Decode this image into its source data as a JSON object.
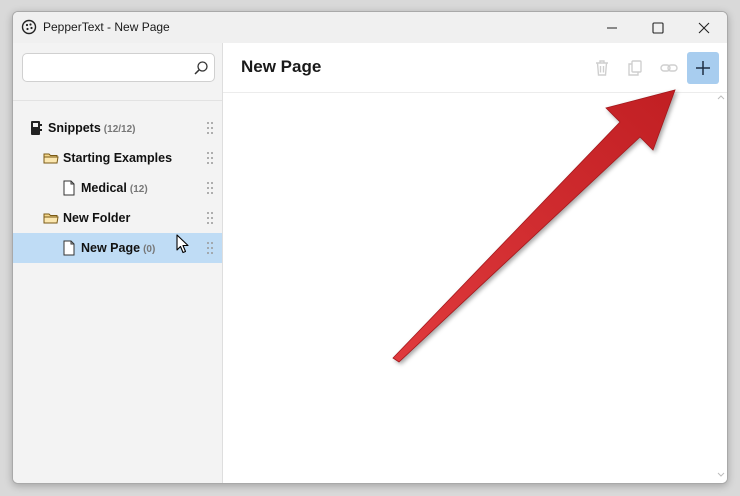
{
  "window": {
    "title": "PepperText - New Page"
  },
  "search": {
    "placeholder": "",
    "value": ""
  },
  "tree": [
    {
      "label": "Snippets",
      "count": "(12/12)",
      "icon": "notebook-icon"
    },
    {
      "label": "Starting Examples",
      "count": "",
      "icon": "folder-icon"
    },
    {
      "label": "Medical",
      "count": "(12)",
      "icon": "page-icon"
    },
    {
      "label": "New Folder",
      "count": "",
      "icon": "folder-icon"
    },
    {
      "label": "New Page",
      "count": "(0)",
      "icon": "page-icon",
      "selected": true
    }
  ],
  "main": {
    "title": "New Page"
  },
  "toolbar": {
    "icons": [
      "trash-icon",
      "copy-icon",
      "link-icon",
      "plus-icon"
    ]
  },
  "colors": {
    "selected_row": "#bfdcf5",
    "add_button": "#a8cdef",
    "annotation_arrow": "#d1262a"
  }
}
